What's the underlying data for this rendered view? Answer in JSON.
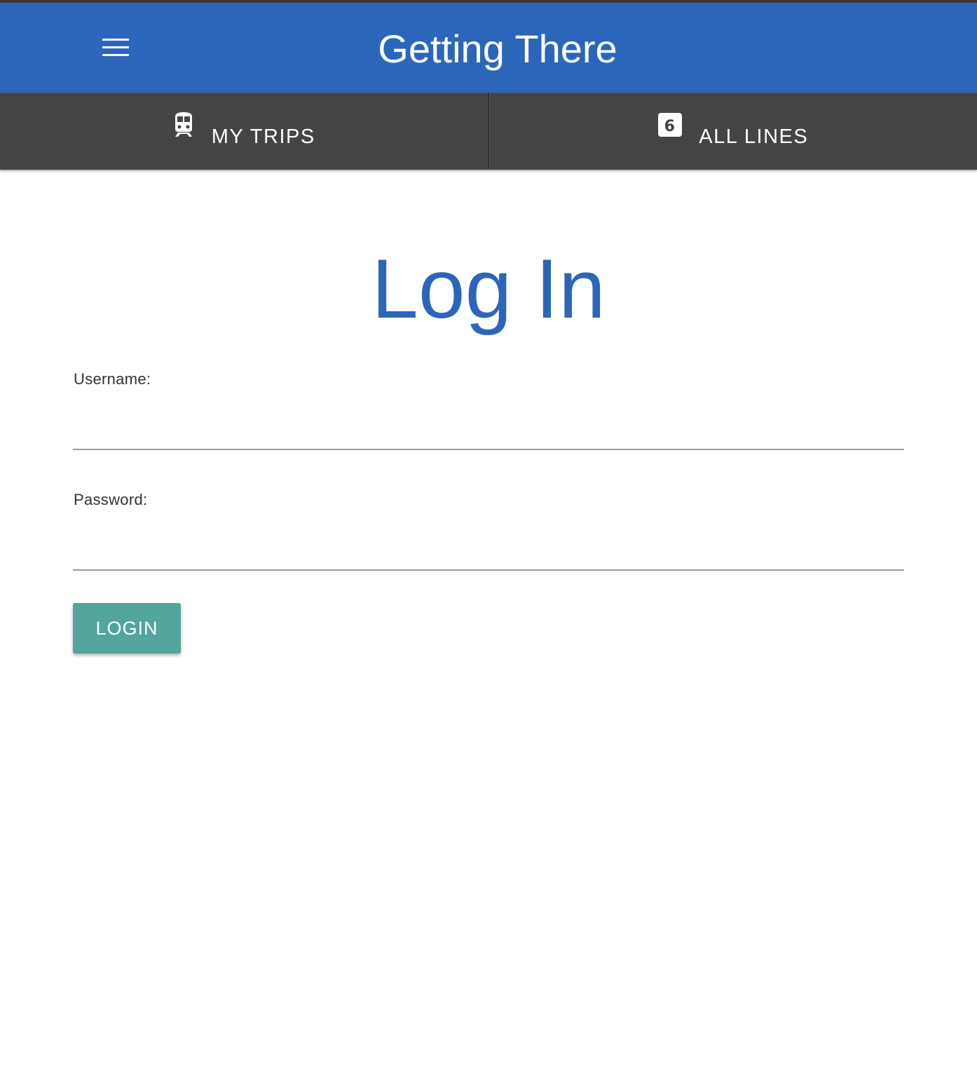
{
  "app": {
    "title": "Getting There"
  },
  "header": {
    "menu_icon": "hamburger-menu-icon"
  },
  "tabs": [
    {
      "label": "MY TRIPS",
      "icon": "train-icon"
    },
    {
      "label": "ALL LINES",
      "icon": "line-6-badge-icon",
      "badge_text": "6"
    }
  ],
  "page": {
    "heading": "Log In"
  },
  "form": {
    "username_label": "Username:",
    "username_value": "",
    "password_label": "Password:",
    "password_value": "",
    "submit_label": "LOGIN"
  },
  "colors": {
    "primary": "#2b66ba",
    "tab_bar": "#444444",
    "button": "#52a59c"
  }
}
